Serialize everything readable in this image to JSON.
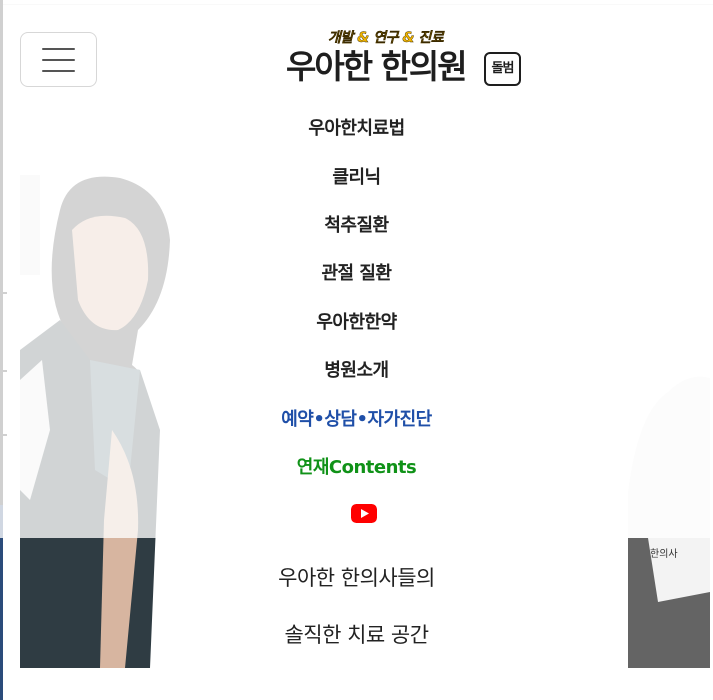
{
  "header": {
    "menu_label": "메뉴",
    "logo": {
      "tagline": "개발 & 연구 & 진료",
      "name": "우아한 한의원",
      "badge": "돌범"
    }
  },
  "nav": {
    "items": [
      {
        "label": "우아한치료법"
      },
      {
        "label": "클리닉"
      },
      {
        "label": "척추질환"
      },
      {
        "label": "관절 질환"
      },
      {
        "label": "우아한한약"
      },
      {
        "label": "병원소개"
      },
      {
        "label": "예약•상담•자가진단",
        "color": "#1f4fa8"
      },
      {
        "label": "연재Contents",
        "color": "#109218"
      }
    ],
    "youtube_icon": "youtube-icon",
    "youtube_color": "#ff0000"
  },
  "hero": {
    "line1": "우아한 한의사들의",
    "line2": "솔직한 치료 공간"
  }
}
